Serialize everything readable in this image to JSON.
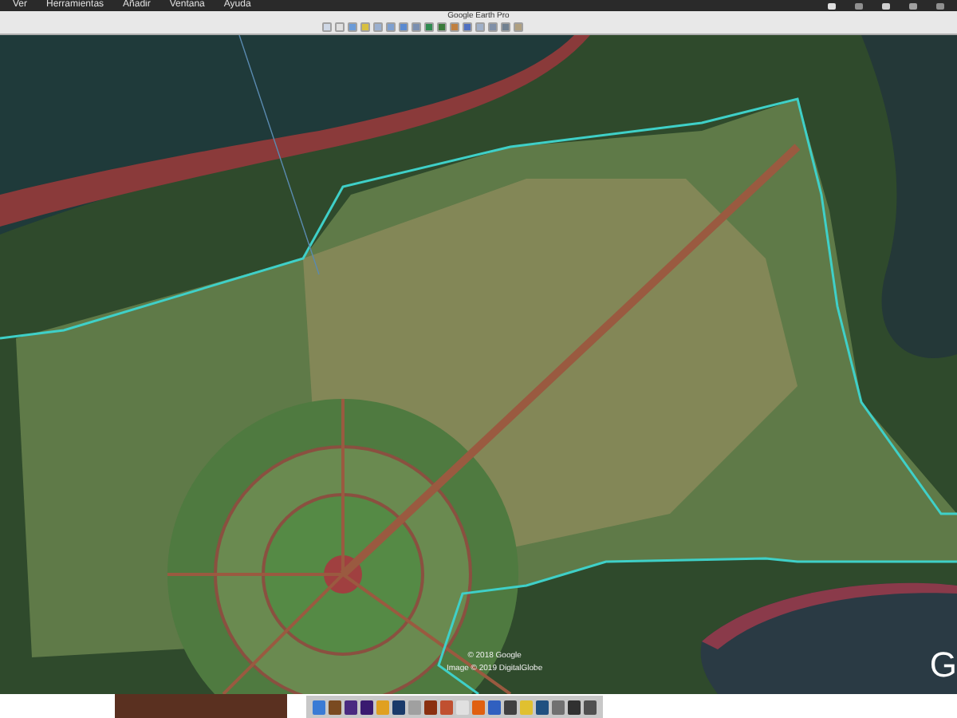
{
  "menu_bar": {
    "items": [
      "Ver",
      "Herramientas",
      "Añadir",
      "Ventana",
      "Ayuda"
    ]
  },
  "window": {
    "title": "Google Earth Pro"
  },
  "map": {
    "attribution": [
      "© 2018 Google",
      "Image © 2019 DigitalGlobe"
    ],
    "logo": "G"
  }
}
